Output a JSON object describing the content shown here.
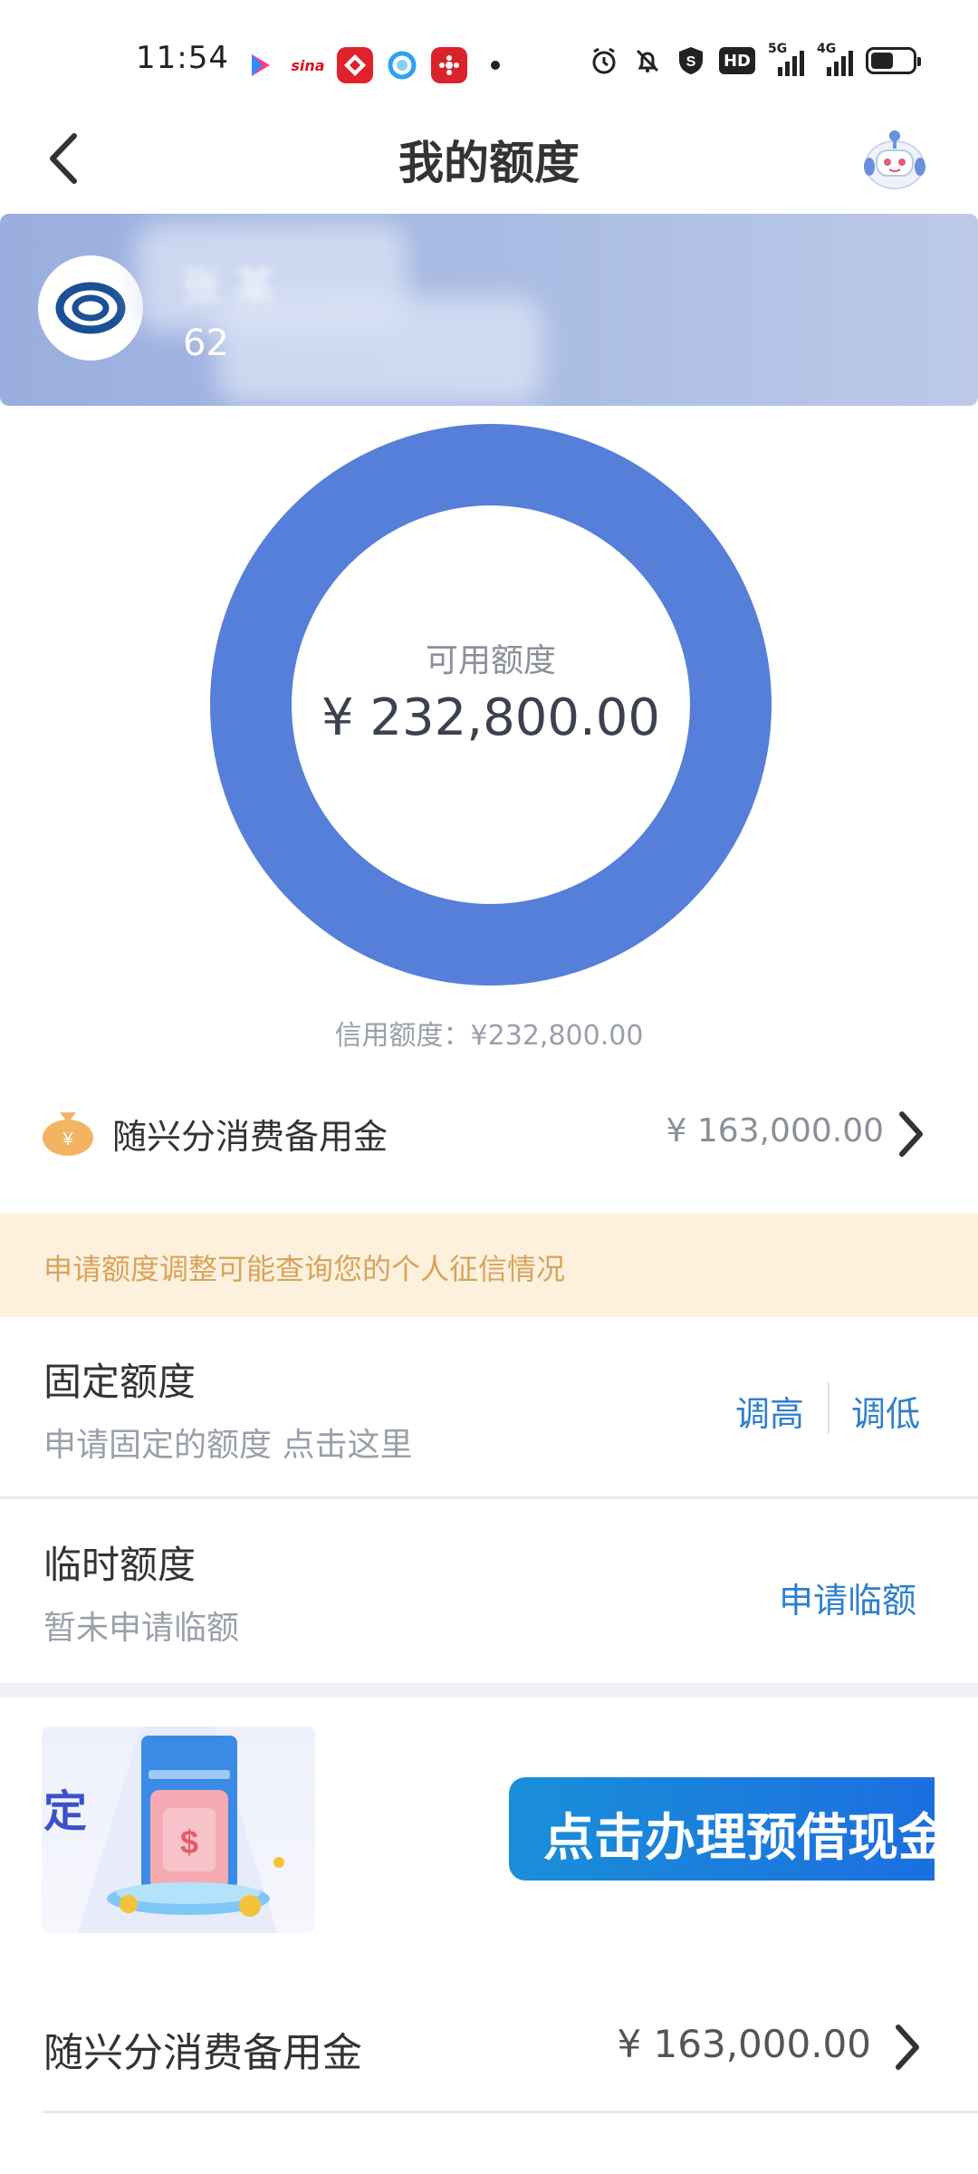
{
  "status_bar": {
    "time": "11:54",
    "network_5g": "5G",
    "network_4g": "4G",
    "hd_badge": "HD"
  },
  "nav": {
    "title": "我的额度"
  },
  "card": {
    "holder_name": "张 某",
    "number_prefix": "62"
  },
  "limit_ring": {
    "label": "可用额度",
    "value": "¥ 232,800.00",
    "available_fraction": 1.0,
    "ring_color": "#557fd8",
    "credit_line_text": "信用额度：¥232,800.00"
  },
  "reserve": {
    "label": "随兴分消费备用金",
    "amount": "¥ 163,000.00"
  },
  "notice": {
    "text": "申请额度调整可能查询您的个人征信情况"
  },
  "fixed_quota": {
    "title": "固定额度",
    "subtitle": "申请固定的额度 点击这里",
    "raise_label": "调高",
    "lower_label": "调低"
  },
  "temp_quota": {
    "title": "临时额度",
    "subtitle": "暂未申请临额",
    "apply_label": "申请临额"
  },
  "promo": {
    "thumb_char": "定",
    "banner_text": "点击办理预借现金"
  },
  "bottom_reserve": {
    "label": "随兴分消费备用金",
    "amount": "¥ 163,000.00"
  },
  "colors": {
    "accent_link": "#2f7fd0",
    "ring": "#557fd8",
    "notice_bg": "#fdf1dd",
    "notice_text": "#d9a35a"
  }
}
